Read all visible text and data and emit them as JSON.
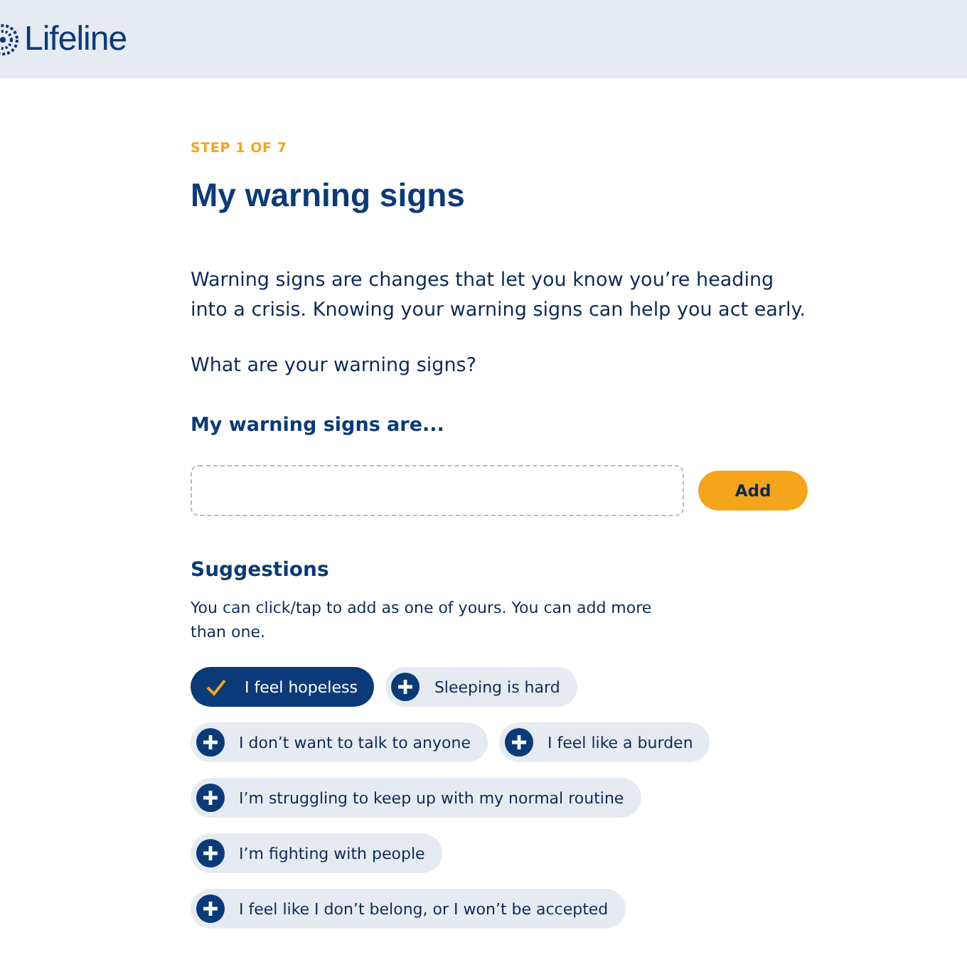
{
  "header": {
    "logo": "Lifeline"
  },
  "step": "STEP 1 OF 7",
  "title": "My warning signs",
  "intro": "Warning signs are changes that let you know you’re heading into a crisis. Knowing your warning signs can help you act early.",
  "question": "What are your warning signs?",
  "input_label": "My warning signs are...",
  "add_button": "Add",
  "suggestions": {
    "title": "Suggestions",
    "hint": "You can click/tap to add as one of yours. You can add more than one.",
    "items": [
      {
        "label": "I feel hopeless",
        "selected": true
      },
      {
        "label": "Sleeping is hard",
        "selected": false
      },
      {
        "label": "I don’t want to talk to anyone",
        "selected": false
      },
      {
        "label": "I feel like a burden",
        "selected": false
      },
      {
        "label": "I’m struggling to keep up with my normal routine",
        "selected": false
      },
      {
        "label": "I’m fighting with people",
        "selected": false
      },
      {
        "label": "I feel like I don’t belong, or I won’t be accepted",
        "selected": false
      }
    ]
  }
}
